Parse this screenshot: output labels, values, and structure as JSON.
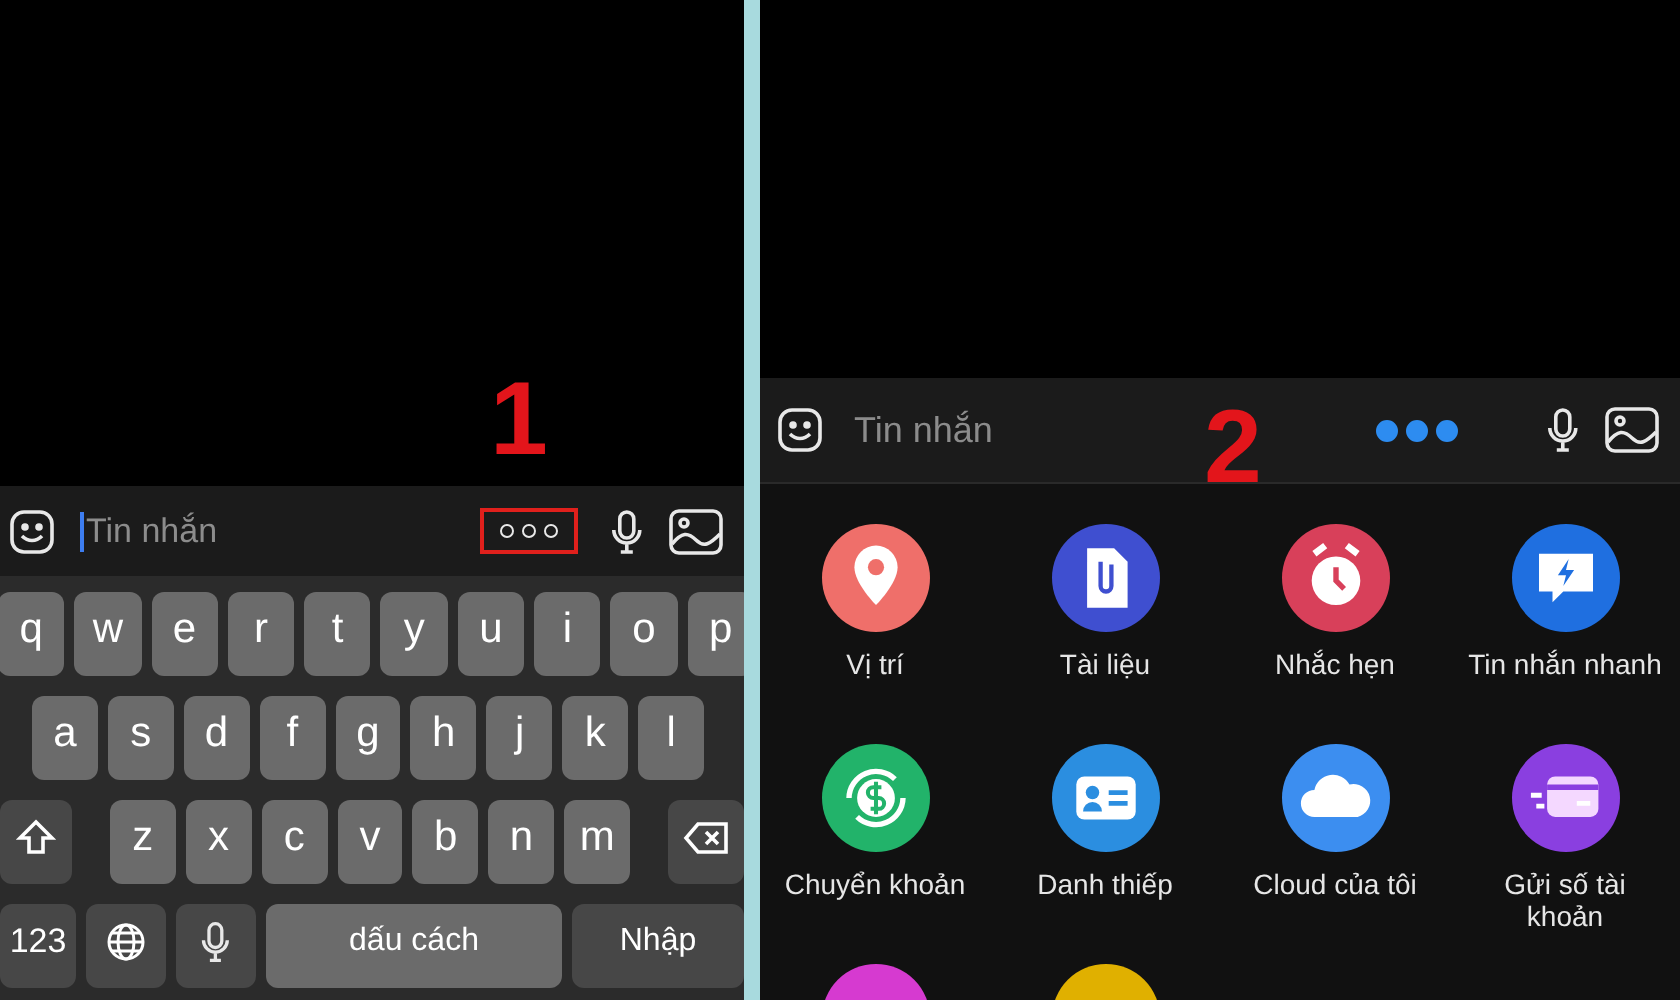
{
  "panels": [
    {
      "step_number": "1",
      "composer": {
        "placeholder": "Tin nhắn",
        "focused": true,
        "more_active": false,
        "more_highlighted": true
      },
      "keyboard": {
        "rows": [
          {
            "keys": [
              {
                "kind": "letter",
                "label": "q"
              },
              {
                "kind": "letter",
                "label": "w"
              },
              {
                "kind": "letter",
                "label": "e"
              },
              {
                "kind": "letter",
                "label": "r"
              },
              {
                "kind": "letter",
                "label": "t"
              },
              {
                "kind": "letter",
                "label": "y"
              },
              {
                "kind": "letter",
                "label": "u"
              },
              {
                "kind": "letter",
                "label": "i"
              },
              {
                "kind": "letter",
                "label": "o"
              },
              {
                "kind": "letter",
                "label": "p"
              }
            ]
          },
          {
            "keys": [
              {
                "kind": "letter",
                "label": "a"
              },
              {
                "kind": "letter",
                "label": "s"
              },
              {
                "kind": "letter",
                "label": "d"
              },
              {
                "kind": "letter",
                "label": "f"
              },
              {
                "kind": "letter",
                "label": "g"
              },
              {
                "kind": "letter",
                "label": "h"
              },
              {
                "kind": "letter",
                "label": "j"
              },
              {
                "kind": "letter",
                "label": "k"
              },
              {
                "kind": "letter",
                "label": "l"
              }
            ]
          },
          {
            "keys": [
              {
                "kind": "shift"
              },
              {
                "kind": "letter",
                "label": "z"
              },
              {
                "kind": "letter",
                "label": "x"
              },
              {
                "kind": "letter",
                "label": "c"
              },
              {
                "kind": "letter",
                "label": "v"
              },
              {
                "kind": "letter",
                "label": "b"
              },
              {
                "kind": "letter",
                "label": "n"
              },
              {
                "kind": "letter",
                "label": "m"
              },
              {
                "kind": "backspace"
              }
            ]
          },
          {
            "keys": [
              {
                "kind": "mode",
                "label": "123"
              },
              {
                "kind": "globe"
              },
              {
                "kind": "mic"
              },
              {
                "kind": "space",
                "label": "dấu cách"
              },
              {
                "kind": "return",
                "label": "Nhập"
              }
            ]
          }
        ]
      }
    },
    {
      "step_number": "2",
      "composer": {
        "placeholder": "Tin nhắn",
        "focused": false,
        "more_active": true,
        "more_highlighted": false
      },
      "options": [
        {
          "kind": "location",
          "label": "Vị trí",
          "color": "#ef6f6a"
        },
        {
          "kind": "document",
          "label": "Tài liệu",
          "color": "#3f4fd0"
        },
        {
          "kind": "reminder",
          "label": "Nhắc hẹn",
          "color": "#d8405a"
        },
        {
          "kind": "quick-message",
          "label": "Tin nhắn nhanh",
          "color": "#1f6fe0"
        },
        {
          "kind": "transfer",
          "label": "Chuyển khoản",
          "color": "#22b36a"
        },
        {
          "kind": "contact-card",
          "label": "Danh thiếp",
          "color": "#2b8ee0"
        },
        {
          "kind": "cloud",
          "label": "Cloud của tôi",
          "color": "#3c8ef0"
        },
        {
          "kind": "bank-card",
          "label": "Gửi số tài khoản",
          "color": "#8a3fe0"
        },
        {
          "kind": "partial",
          "color": "#d63ad0"
        },
        {
          "kind": "partial",
          "color": "#e0b000"
        }
      ]
    }
  ]
}
